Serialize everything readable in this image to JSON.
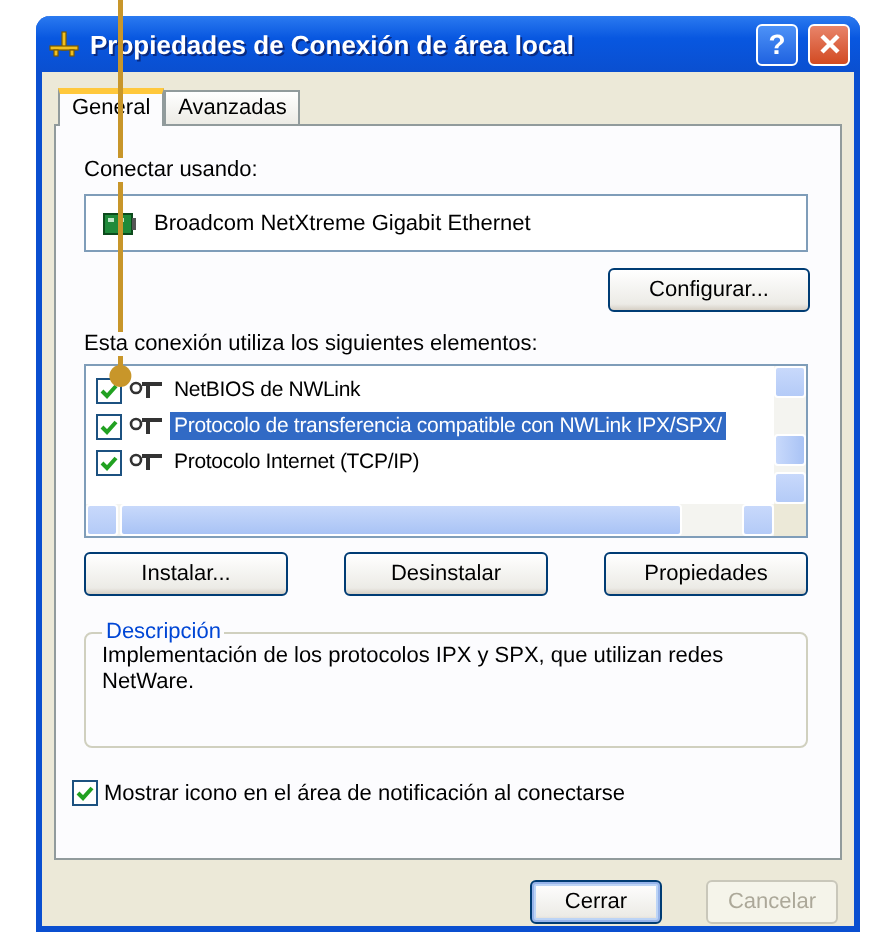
{
  "window": {
    "title": "Propiedades de Conexión de área local",
    "help": "?"
  },
  "tabs": [
    {
      "label": "General",
      "selected": true
    },
    {
      "label": "Avanzadas",
      "selected": false
    }
  ],
  "connect_using": {
    "label": "Conectar usando:",
    "adapter": "Broadcom NetXtreme Gigabit Ethernet"
  },
  "configure_button": {
    "label": "Configurar..."
  },
  "components_label": "Esta conexión utiliza los siguientes elementos:",
  "components": [
    {
      "label": "NetBIOS de NWLink",
      "checked": true,
      "selected": false
    },
    {
      "label": "Protocolo de transferencia compatible con NWLink IPX/SPX/",
      "checked": true,
      "selected": true
    },
    {
      "label": "Protocolo Internet (TCP/IP)",
      "checked": true,
      "selected": false
    }
  ],
  "component_buttons": [
    {
      "label": "Instalar..."
    },
    {
      "label": "Desinstalar"
    },
    {
      "label": "Propiedades"
    }
  ],
  "description": {
    "title": "Descripción",
    "text": "Implementación de los protocolos IPX y SPX, que utilizan redes NetWare."
  },
  "notify_checkbox": {
    "label": "Mostrar icono en el área de notificación al conectarse",
    "checked": true
  },
  "dialog_buttons": [
    {
      "label": "Cerrar",
      "disabled": false
    },
    {
      "label": "Cancelar",
      "disabled": true
    }
  ]
}
